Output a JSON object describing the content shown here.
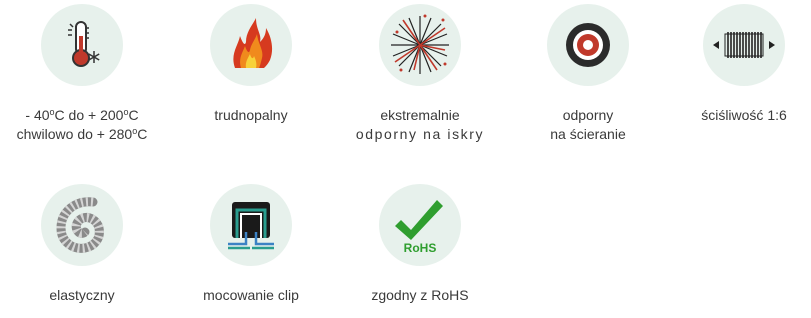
{
  "features": [
    {
      "id": "temperature",
      "icon": "thermometer-snowflake-icon",
      "lines": [
        {
          "parts": [
            "- 40",
            "o",
            "C do + 200",
            "o",
            "C"
          ]
        },
        {
          "parts": [
            "chwilowo do + 280",
            "o",
            "C"
          ]
        }
      ]
    },
    {
      "id": "flame",
      "icon": "flame-icon",
      "lines": [
        "trudnopalny"
      ]
    },
    {
      "id": "sparks",
      "icon": "spark-burst-icon",
      "lines": [
        "ekstremalnie",
        "odporny na iskry"
      ]
    },
    {
      "id": "abrasion",
      "icon": "abrasion-tire-icon",
      "lines": [
        "odporny",
        "na ścieranie"
      ]
    },
    {
      "id": "compressibility",
      "icon": "compression-spring-icon",
      "lines": [
        "ściśliwość 1:6"
      ]
    },
    {
      "id": "elastic",
      "icon": "flexible-hose-icon",
      "lines": [
        "elastyczny"
      ]
    },
    {
      "id": "clip",
      "icon": "clip-mount-icon",
      "lines": [
        "mocowanie clip"
      ]
    },
    {
      "id": "rohs",
      "icon": "rohs-check-icon",
      "lines": [
        "zgodny z RoHS"
      ],
      "icon_text": "RoHS"
    }
  ],
  "colors": {
    "circle_bg": "#e7f1ec",
    "text": "#3a3a3a",
    "rohs_green": "#2f9e2f"
  }
}
